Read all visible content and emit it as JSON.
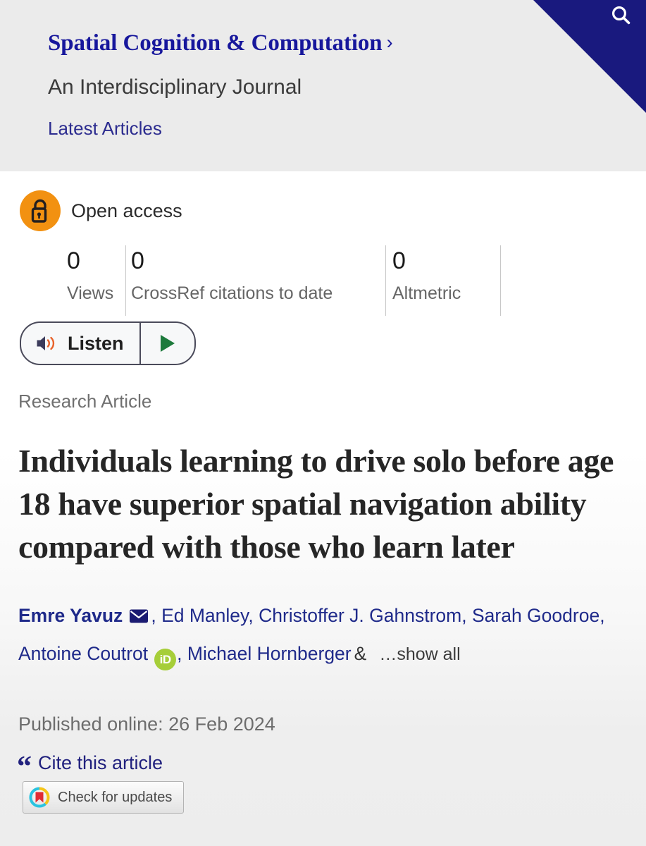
{
  "header": {
    "journal_title": "Spatial Cognition & Computation",
    "chevron": "›",
    "subtitle": "An Interdisciplinary Journal",
    "latest_articles": "Latest Articles",
    "search_icon": "search-icon"
  },
  "access": {
    "badge_icon": "open-access-unlock-icon",
    "label": "Open access"
  },
  "metrics": [
    {
      "value": "0",
      "label": "Views"
    },
    {
      "value": "0",
      "label": "CrossRef citations to date"
    },
    {
      "value": "0",
      "label": "Altmetric"
    }
  ],
  "listen": {
    "label": "Listen",
    "speaker_icon": "speaker-icon",
    "play_icon": "play-icon"
  },
  "article": {
    "type": "Research Article",
    "title": "Individuals learning to drive solo before age 18 have superior spatial navigation ability compared with those who learn later",
    "published": "Published online: 26 Feb 2024"
  },
  "authors": {
    "list": [
      {
        "name": "Emre Yavuz",
        "bold": true,
        "email": true,
        "orcid": false
      },
      {
        "name": "Ed Manley",
        "bold": false,
        "email": false,
        "orcid": false
      },
      {
        "name": "Christoffer J. Gahnstrom",
        "bold": false,
        "email": false,
        "orcid": false
      },
      {
        "name": "Sarah Goodroe",
        "bold": false,
        "email": false,
        "orcid": false
      },
      {
        "name": "Antoine Coutrot",
        "bold": false,
        "email": false,
        "orcid": true
      },
      {
        "name": "Michael Hornberger",
        "bold": false,
        "email": false,
        "orcid": false
      }
    ],
    "ampersand": "&",
    "show_all": "…show all",
    "comma": ",",
    "orcid_label": "iD"
  },
  "cite": {
    "quote_glyph": "“",
    "label": "Cite this article"
  },
  "crossmark": {
    "label": "Check for updates",
    "icon": "crossmark-icon"
  },
  "colors": {
    "journal_blue": "#17179c",
    "link_blue": "#2c2c8f",
    "author_blue": "#1f2a8a",
    "open_access_orange": "#f29111",
    "orcid_green": "#a6ce39",
    "search_navy": "#19197e",
    "play_green": "#1d7a3c",
    "header_bg": "#ebebeb"
  }
}
